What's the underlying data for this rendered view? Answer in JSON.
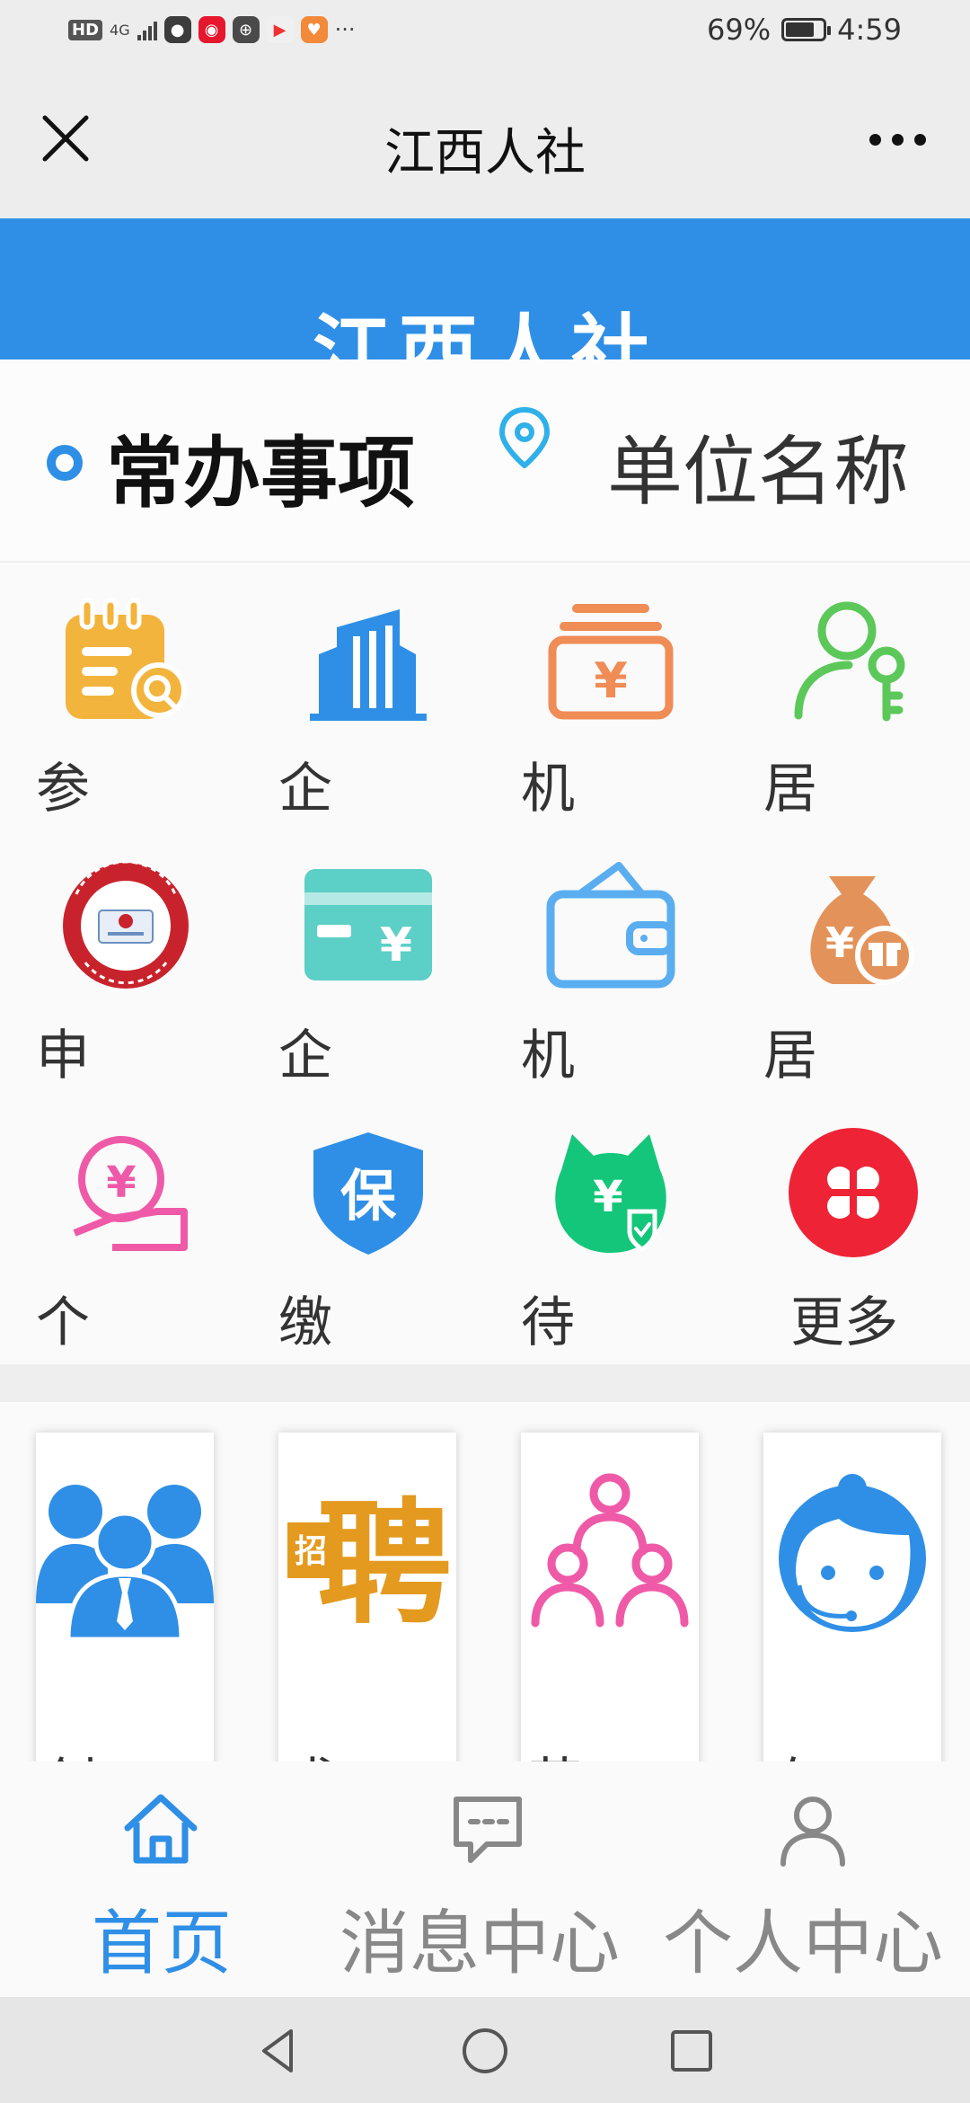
{
  "status_bar": {
    "hd": "HD",
    "network": "4G",
    "more": "···",
    "battery_percent": "69%",
    "battery_level": 0.69,
    "time": "4:59"
  },
  "title_bar": {
    "title": "江西人社"
  },
  "banner": {
    "title": "江西人社"
  },
  "common": {
    "title": "常办事项",
    "unit_name": "单位名称"
  },
  "grid": {
    "items": [
      {
        "label": "参",
        "icon": "clipboard-search-icon"
      },
      {
        "label": "企",
        "icon": "building-icon"
      },
      {
        "label": "机",
        "icon": "yuan-card-icon"
      },
      {
        "label": "居",
        "icon": "person-key-icon"
      },
      {
        "label": "申",
        "icon": "social-security-card-icon"
      },
      {
        "label": "企",
        "icon": "bank-card-yuan-icon"
      },
      {
        "label": "机",
        "icon": "wallet-icon"
      },
      {
        "label": "居",
        "icon": "money-bag-gift-icon"
      },
      {
        "label": "个",
        "icon": "hand-coin-icon"
      },
      {
        "label": "缴",
        "icon": "shield-bao-icon"
      },
      {
        "label": "待",
        "icon": "yuan-shield-icon"
      },
      {
        "label": "更多",
        "icon": "more-apps-icon"
      }
    ]
  },
  "promo": {
    "cards": [
      {
        "label": "创",
        "icon": "team-icon"
      },
      {
        "label": "求",
        "icon": "recruit-pin-icon"
      },
      {
        "label": "劳",
        "icon": "network-people-icon"
      },
      {
        "label": "在",
        "icon": "customer-service-icon"
      }
    ],
    "recruit_glyph": "聘",
    "recruit_small": "招"
  },
  "bottom_nav": {
    "items": [
      {
        "label": "首页",
        "icon": "home-icon",
        "active": true
      },
      {
        "label": "消息中心",
        "icon": "message-icon",
        "active": false
      },
      {
        "label": "个人中心",
        "icon": "person-icon",
        "active": false
      }
    ]
  },
  "colors": {
    "accent": "#2f8fe6",
    "yellow": "#f2b43c",
    "orange": "#f08c55",
    "green": "#5cc85a",
    "red": "#c8232c",
    "teal": "#5ccfc6",
    "sky": "#5aaef0",
    "tan": "#e3935a",
    "pink": "#ef5aa8",
    "emerald": "#14c67a",
    "crimson": "#ee2436",
    "gold": "#e39a1f",
    "inactive": "#888888"
  }
}
